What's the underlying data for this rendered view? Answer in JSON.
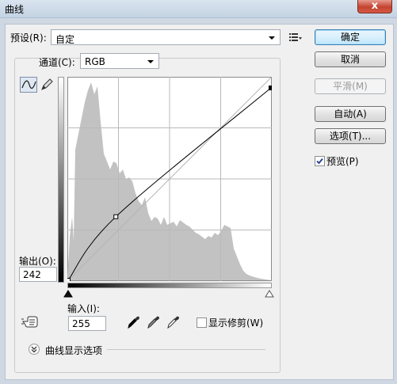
{
  "window": {
    "title": "曲线",
    "close_glyph": "x"
  },
  "preset": {
    "label": "预设(R):",
    "value": "自定",
    "menu_icon": "preset-options-icon"
  },
  "channel": {
    "label": "通道(C):",
    "value": "RGB"
  },
  "tools": {
    "curve_point_icon": "curve-point-tool-icon",
    "pencil_icon": "pencil-icon"
  },
  "output": {
    "label": "输出(O):",
    "value": "242"
  },
  "input": {
    "label": "输入(I):",
    "value": "255"
  },
  "eyedroppers": [
    "black-point-eyedropper-icon",
    "gray-point-eyedropper-icon",
    "white-point-eyedropper-icon"
  ],
  "clipping": {
    "label": "显示修剪(W)",
    "checked": false
  },
  "curve_options": {
    "label": "曲线显示选项"
  },
  "buttons": {
    "ok": "确定",
    "cancel": "取消",
    "smooth": "平滑(M)",
    "auto": "自动(A)",
    "options": "选项(T)..."
  },
  "preview": {
    "label": "预览(P)",
    "checked": true
  },
  "curve": {
    "points": [
      [
        0,
        0
      ],
      [
        60,
        80
      ],
      [
        255,
        242
      ]
    ],
    "colors": {
      "histogram": "#c2c2c2",
      "curve": "#000000",
      "grid": "#b9b9b9"
    }
  }
}
